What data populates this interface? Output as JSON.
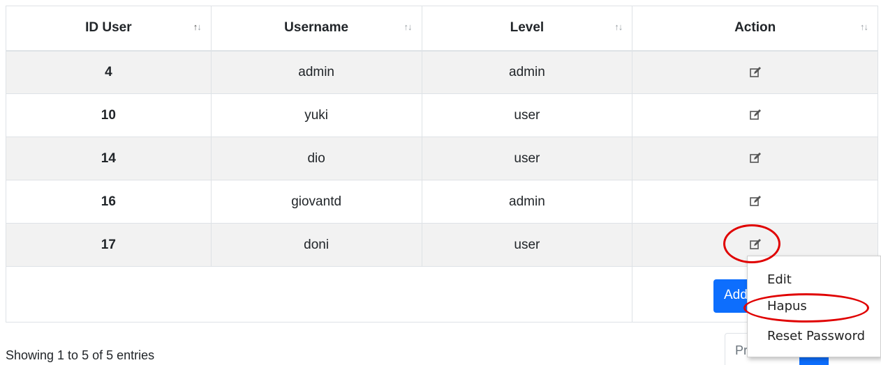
{
  "table": {
    "headers": [
      "ID User",
      "Username",
      "Level",
      "Action"
    ],
    "sort_icon": "sort-arrows-icon",
    "rows": [
      {
        "id": "4",
        "username": "admin",
        "level": "admin"
      },
      {
        "id": "10",
        "username": "yuki",
        "level": "user"
      },
      {
        "id": "14",
        "username": "dio",
        "level": "user"
      },
      {
        "id": "16",
        "username": "giovantd",
        "level": "admin"
      },
      {
        "id": "17",
        "username": "doni",
        "level": "user"
      }
    ],
    "action_icon": "edit-icon"
  },
  "add_button": {
    "label": "Add"
  },
  "info": "Showing 1 to 5 of 5 entries",
  "pagination": {
    "previous": "Previous"
  },
  "context_menu": {
    "items": [
      "Edit",
      "Hapus",
      "Reset Password"
    ]
  },
  "colors": {
    "primary": "#0d6efd",
    "stripe": "#f2f2f2",
    "highlight": "#e00000"
  }
}
